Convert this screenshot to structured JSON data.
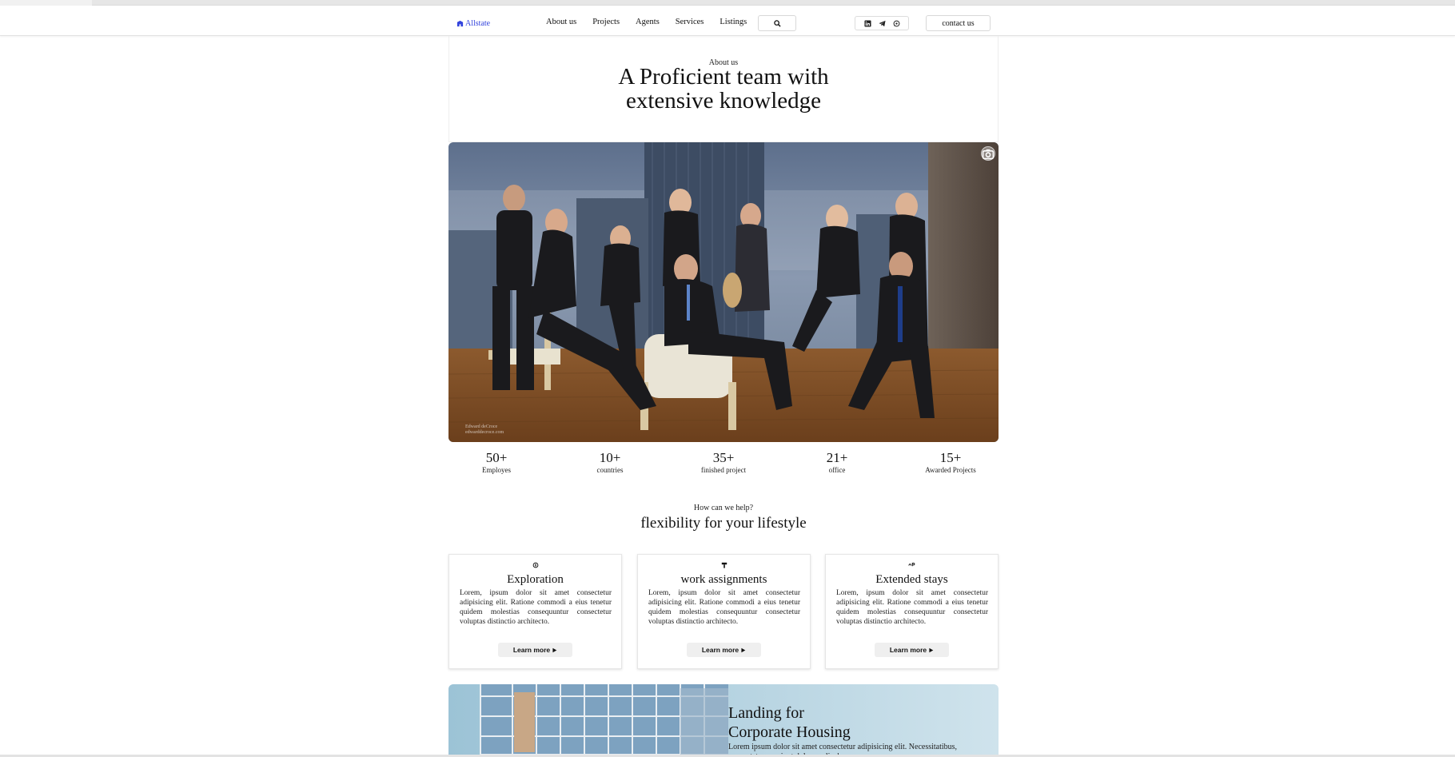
{
  "header": {
    "logo_text": "Allstate",
    "logo_icon": "building-icon",
    "nav": [
      "About us",
      "Projects",
      "Agents",
      "Services",
      "Listings"
    ],
    "search_icon": "search-icon",
    "social_icons": [
      "linkedin-icon",
      "telegram-icon",
      "whatsapp-icon"
    ],
    "contact_label": "contact us"
  },
  "hero": {
    "eyebrow": "About us",
    "title_line1": "A Proficient team with",
    "title_line2": "extensive knowledge",
    "photo_credit_line1": "Edward deCroce",
    "photo_credit_line2": "edwarddecroce.com"
  },
  "stats": [
    {
      "value": "50+",
      "label": "Employes"
    },
    {
      "value": "10+",
      "label": "countries"
    },
    {
      "value": "35+",
      "label": "finished project"
    },
    {
      "value": "21+",
      "label": "office"
    },
    {
      "value": "15+",
      "label": "Awarded Projects"
    }
  ],
  "help": {
    "eyebrow": "How can we help?",
    "title": "flexibility for your lifestyle"
  },
  "cards": [
    {
      "icon": "compass-icon",
      "title": "Exploration",
      "text": "Lorem, ipsum dolor sit amet consectetur adipisicing elit. Ratione commodi a eius tenetur quidem molestias consequuntur consectetur voluptas distinctio architecto.",
      "button": "Learn more"
    },
    {
      "icon": "hammer-icon",
      "title": "work assignments",
      "text": "Lorem, ipsum dolor sit amet consectetur adipisicing elit. Ratione commodi a eius tenetur quidem molestias consequuntur consectetur voluptas distinctio architecto.",
      "button": "Learn more"
    },
    {
      "icon": "up-arrow-icon",
      "title": "Extended stays",
      "text": "Lorem, ipsum dolor sit amet consectetur adipisicing elit. Ratione commodi a eius tenetur quidem molestias consequuntur consectetur voluptas distinctio architecto.",
      "button": "Learn more"
    }
  ],
  "banner": {
    "title_line1": "Landing for",
    "title_line2": "Corporate Housing",
    "text": "Lorem ipsum dolor sit amet consectetur adipisicing elit. Necessitatibus, consectetur nesciunt dolor explicabo."
  },
  "colors": {
    "logo": "#3344dd",
    "button_bg": "#efefef",
    "text": "#111111"
  }
}
